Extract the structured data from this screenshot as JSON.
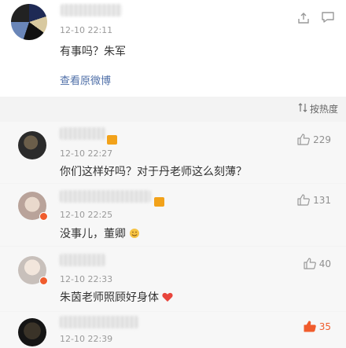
{
  "post": {
    "time": "12-10 22:11",
    "text": "有事吗？朱军",
    "view_original": "查看原微博"
  },
  "sort": {
    "label": "按热度"
  },
  "comments": [
    {
      "time": "12-10 22:27",
      "text": "你们这样好吗？对于丹老师这么刻薄？",
      "likes": "229",
      "liked": false
    },
    {
      "time": "12-10 22:25",
      "text": "没事儿，董卿",
      "likes": "131",
      "liked": false
    },
    {
      "time": "12-10 22:33",
      "text": "朱茵老师照顾好身体",
      "likes": "40",
      "liked": false
    },
    {
      "time": "12-10 22:39",
      "text": "",
      "likes": "35",
      "liked": true
    }
  ],
  "colors": {
    "link": "#4f6fa8",
    "liked": "#f05c2d",
    "heart": "#e8453c"
  }
}
